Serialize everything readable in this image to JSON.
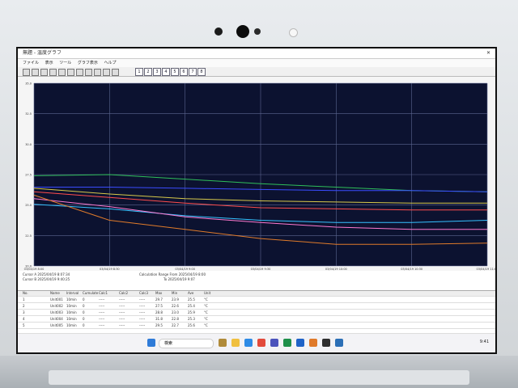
{
  "window": {
    "title": "無題 - 温度グラフ"
  },
  "menu": [
    "ファイル",
    "表示",
    "ツール",
    "グラフ表示",
    "ヘルプ"
  ],
  "toolbar": {
    "numbers": [
      "1",
      "2",
      "3",
      "4",
      "5",
      "6",
      "7",
      "8"
    ]
  },
  "info": {
    "line1": "Cursor A 2025/04/19 8:07:34",
    "line2": "Cursor B 2025/04/19 9:40:25",
    "line3": "Calculation Range From 2025/04/19 8:00",
    "line4": "To 2025/04/19 9:07"
  },
  "table": {
    "headers": [
      "No.",
      "Name",
      "Interval",
      "Cumulate",
      "Calc1",
      "Calc2",
      "Calc3",
      "Max",
      "Min",
      "Ave",
      "Unit"
    ],
    "rows": [
      [
        "1",
        "Unit001",
        "10min",
        "0",
        "-----",
        "-----",
        "-----",
        "29.7",
        "23.9",
        "25.5",
        "°C"
      ],
      [
        "2",
        "Unit002",
        "10min",
        "0",
        "-----",
        "-----",
        "-----",
        "27.5",
        "22.6",
        "25.4",
        "°C"
      ],
      [
        "3",
        "Unit003",
        "10min",
        "0",
        "-----",
        "-----",
        "-----",
        "28.8",
        "23.0",
        "25.9",
        "°C"
      ],
      [
        "4",
        "Unit004",
        "10min",
        "0",
        "-----",
        "-----",
        "-----",
        "31.8",
        "22.8",
        "25.3",
        "°C"
      ],
      [
        "5",
        "Unit005",
        "10min",
        "0",
        "-----",
        "-----",
        "-----",
        "29.5",
        "22.7",
        "25.6",
        "°C"
      ]
    ]
  },
  "chart_data": {
    "type": "line",
    "x": [
      "2025/04/19 8:00",
      "2025/04/19 8:30",
      "2025/04/19 9:00",
      "2025/04/19 9:30",
      "2025/04/19 10:00",
      "2025/04/19 10:30",
      "2025/04/19 11:00"
    ],
    "xtick_labels": [
      "03/04/19 8:00",
      "03/04/19 8:30",
      "03/04/19 9:00",
      "03/04/19 9:30",
      "03/04/19 10:00",
      "03/04/19 10:30",
      "03/04/19 11:00"
    ],
    "ytick_labels": [
      "35.0",
      "32.5",
      "30.0",
      "27.5",
      "25.0",
      "22.5",
      "20.0"
    ],
    "ylim": [
      20,
      36
    ],
    "grid": true,
    "series": [
      {
        "color": "#2fbf5a",
        "values": [
          27.9,
          28.0,
          27.6,
          27.2,
          26.9,
          26.6,
          26.5
        ]
      },
      {
        "color": "#3a4cff",
        "values": [
          26.9,
          26.9,
          26.8,
          26.7,
          26.6,
          26.6,
          26.5
        ]
      },
      {
        "color": "#d7c94a",
        "values": [
          26.8,
          26.3,
          25.9,
          25.7,
          25.6,
          25.5,
          25.5
        ]
      },
      {
        "color": "#ff4d4d",
        "values": [
          26.5,
          26.0,
          25.5,
          25.1,
          25.0,
          24.9,
          24.9
        ]
      },
      {
        "color": "#36c2ff",
        "values": [
          25.4,
          25.0,
          24.4,
          24.0,
          23.8,
          23.8,
          24.0
        ]
      },
      {
        "color": "#ff7ad0",
        "values": [
          25.9,
          25.2,
          24.3,
          23.8,
          23.4,
          23.2,
          23.2
        ]
      },
      {
        "color": "#e07b2a",
        "values": [
          26.2,
          24.0,
          23.2,
          22.4,
          21.9,
          21.9,
          22.0
        ]
      }
    ]
  },
  "taskbar": {
    "search_label": "検索",
    "clock": "9:41"
  }
}
